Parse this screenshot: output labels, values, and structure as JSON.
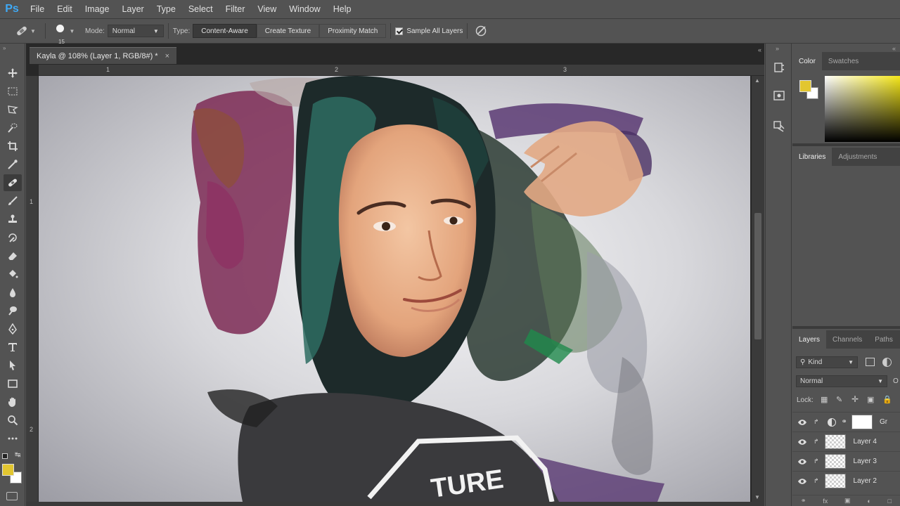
{
  "app": {
    "logo": "Ps",
    "menu": [
      "File",
      "Edit",
      "Image",
      "Layer",
      "Type",
      "Select",
      "Filter",
      "View",
      "Window",
      "Help"
    ]
  },
  "options": {
    "brush_size": "15",
    "mode_label": "Mode:",
    "mode_value": "Normal",
    "type_label": "Type:",
    "type_buttons": [
      "Content-Aware",
      "Create Texture",
      "Proximity Match"
    ],
    "sample_all_layers": "Sample All Layers"
  },
  "document": {
    "tab_title": "Kayla @ 108% (Layer 1, RGB/8#) *",
    "tab_close": "×",
    "ruler_top": [
      "1",
      "2",
      "3"
    ],
    "ruler_left": [
      "1",
      "2"
    ],
    "canvas_text": "TURE"
  },
  "panels": {
    "color_tabs": [
      "Color",
      "Swatches"
    ],
    "library_tabs": [
      "Libraries",
      "Adjustments"
    ],
    "layer_tabs": [
      "Layers",
      "Channels",
      "Paths"
    ],
    "kind_filter": "Kind",
    "blend_mode": "Normal",
    "opacity_abbrev": "O",
    "lock_label": "Lock:",
    "layers": [
      {
        "name": "Gr"
      },
      {
        "name": "Layer 4"
      },
      {
        "name": "Layer 3"
      },
      {
        "name": "Layer 2"
      }
    ]
  },
  "colors": {
    "foreground": "#e2c630",
    "background": "#ffffff",
    "app_bg": "#535353"
  }
}
